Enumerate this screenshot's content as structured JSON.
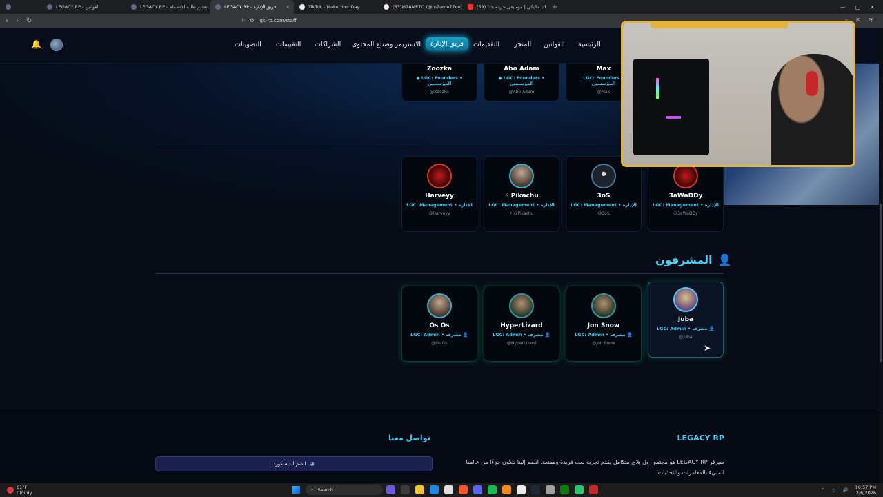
{
  "browser": {
    "tabs": [
      {
        "label": "LEGACY RP - القوانين",
        "icon": "legacy-favicon"
      },
      {
        "label": "LEGACY RP - تقديم طلب الانضمام",
        "icon": "legacy-favicon"
      },
      {
        "label": "LEGACY RP - فريق الإدارة",
        "icon": "legacy-favicon",
        "active": true
      },
      {
        "label": "TikTok - Make Your Day",
        "icon": "tiktok-icon"
      },
      {
        "label": "(33)M7AME7O (@m7ame77oo) | TikTok",
        "icon": "tiktok-icon"
      },
      {
        "label": "(58) الحداك ماليكي | موسيقى حزينة جدا",
        "icon": "youtube-icon"
      }
    ],
    "url": "lgc-rp.com/staff"
  },
  "nav": {
    "items": [
      "الرئيسية",
      "القوانين",
      "المتجر",
      "التقديمات",
      "فريق الإدارة",
      "الاستريمر وصناع المحتوى",
      "الشراكات",
      "التقييمات",
      "التصويتات"
    ]
  },
  "founders": [
    {
      "name": "Max",
      "role1": "LGC: Founders •",
      "role2": "المؤسسين",
      "handle": "@Max"
    },
    {
      "name": "Abo Adam",
      "role1": "LGC: Founders •",
      "role2": "المؤسسين",
      "handle": "@Abo Adam"
    },
    {
      "name": "Zoozka",
      "role1": "LGC: Founders •",
      "role2": "المؤسسين",
      "handle": "@Zoozka"
    }
  ],
  "management": [
    {
      "name": "3aWaDDy",
      "role": "LGC: Management • الإدارة",
      "handle": "@3aWaDDy"
    },
    {
      "name": "3oS",
      "role": "LGC: Management • الإدارة",
      "handle": "@3oS"
    },
    {
      "name": "Pikachu",
      "role": "LGC: Management • الإدارة",
      "handle": "@Pikachu"
    },
    {
      "name": "Harveyy",
      "role": "LGC: Management • الإدارة",
      "handle": "@Harveyy"
    }
  ],
  "supervisors": {
    "title": "المشرفون",
    "members": [
      {
        "name": "Juba",
        "role": "LGC: Admin • مشرف",
        "handle": "@Juba"
      },
      {
        "name": "Jon Snow",
        "role": "LGC: Admin • مشرف",
        "handle": "@Jon Snow"
      },
      {
        "name": "HyperLizard",
        "role": "LGC: Admin • مشرف",
        "handle": "@HyperLizard"
      },
      {
        "name": "Os Os",
        "role": "LGC: Admin • مشرف",
        "handle": "@Os Os"
      }
    ]
  },
  "footer": {
    "brand": "LEGACY RP",
    "contact_title": "تواصل معنا",
    "description": "سيرفر LEGACY RP هو مجتمع رول بلاي متكامل يقدم تجربة لعب فريدة وممتعة. انضم إلينا لتكون جزءًا من عالمنا المليء بالمغامرات والتحديات.",
    "discord_label": "انضم للديسكورد"
  },
  "taskbar": {
    "weather_temp": "61°F",
    "weather_text": "Cloudy",
    "search_placeholder": "Search",
    "time": "10:57 PM",
    "date": "2/6/2026"
  }
}
